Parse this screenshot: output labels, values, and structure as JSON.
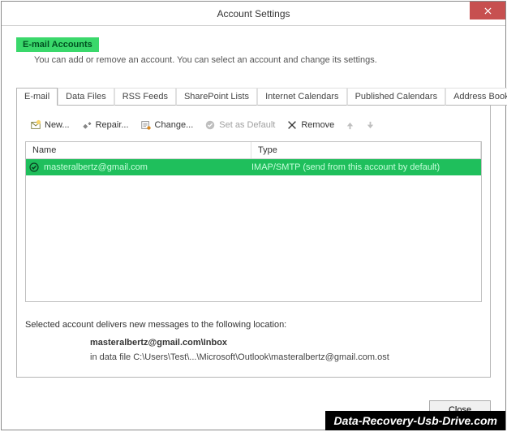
{
  "title": "Account Settings",
  "section": {
    "label": "E-mail Accounts",
    "desc": "You can add or remove an account. You can select an account and change its settings."
  },
  "tabs": [
    "E-mail",
    "Data Files",
    "RSS Feeds",
    "SharePoint Lists",
    "Internet Calendars",
    "Published Calendars",
    "Address Books"
  ],
  "toolbar": {
    "new": "New...",
    "repair": "Repair...",
    "change": "Change...",
    "setdefault": "Set as Default",
    "remove": "Remove"
  },
  "columns": {
    "name": "Name",
    "type": "Type"
  },
  "row": {
    "name": "masteralbertz@gmail.com",
    "type": "IMAP/SMTP (send from this account by default)"
  },
  "deliver": {
    "intro": "Selected account delivers new messages to the following location:",
    "path": "masteralbertz@gmail.com\\Inbox",
    "file": "in data file C:\\Users\\Test\\...\\Microsoft\\Outlook\\masteralbertz@gmail.com.ost"
  },
  "close": "Close",
  "watermark": "Data-Recovery-Usb-Drive.com"
}
